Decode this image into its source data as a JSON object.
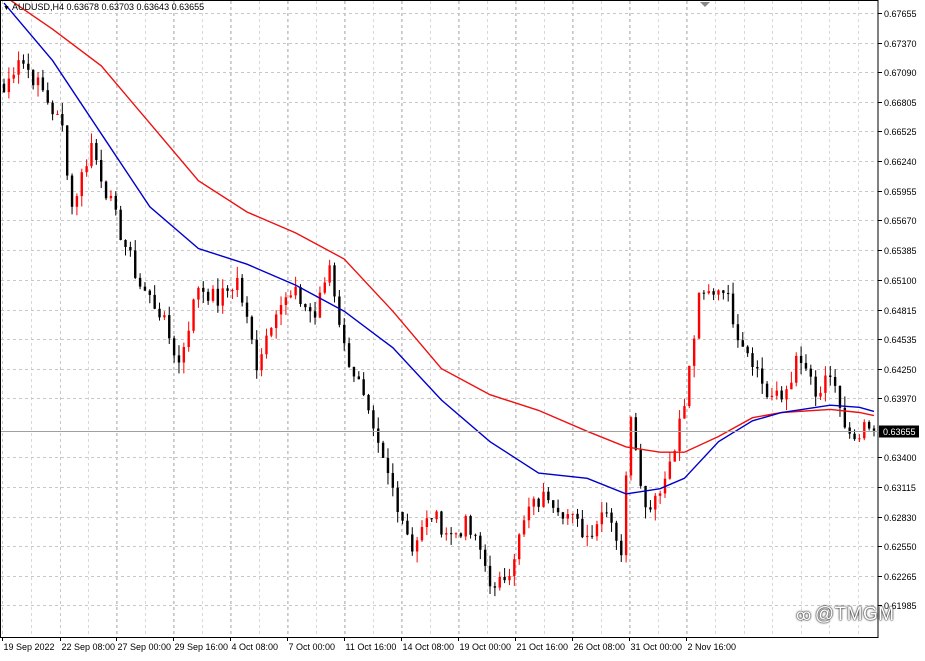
{
  "header": {
    "symbol": "AUDUSD,H4",
    "ohlc": "0.63678 0.63703 0.63643 0.63655"
  },
  "watermark": {
    "text": "@TMGM",
    "icon": "wechat-channel-icon"
  },
  "colors": {
    "background": "#ffffff",
    "grid": "#c8c8c8",
    "bull_candle": "#ff0000",
    "bear_candle": "#000000",
    "ma_fast": "#0000cc",
    "ma_slow": "#ee1111",
    "price_tag_bg": "#000000",
    "price_tag_fg": "#ffffff",
    "current_line": "#a0a0a0"
  },
  "chart_data": {
    "type": "candlestick",
    "symbol": "AUDUSD",
    "timeframe": "H4",
    "grid": true,
    "current_price": 0.63655,
    "y_ticks": [
      0.67655,
      0.6737,
      0.6709,
      0.66805,
      0.66525,
      0.6624,
      0.65955,
      0.6567,
      0.65385,
      0.651,
      0.64815,
      0.64535,
      0.6425,
      0.6397,
      0.634,
      0.63115,
      0.6283,
      0.6255,
      0.62265,
      0.61985
    ],
    "x_labels": [
      "19 Sep 2022",
      "22 Sep 08:00",
      "27 Sep 00:00",
      "29 Sep 16:00",
      "4 Oct 08:00",
      "7 Oct 00:00",
      "11 Oct 16:00",
      "14 Oct 08:00",
      "19 Oct 00:00",
      "21 Oct 16:00",
      "26 Oct 08:00",
      "31 Oct 00:00",
      "2 Nov 16:00"
    ],
    "ylim": [
      0.6168,
      0.6778
    ],
    "candle_count": 180,
    "close_anchors": [
      [
        0,
        0.669
      ],
      [
        3,
        0.6725
      ],
      [
        8,
        0.669
      ],
      [
        12,
        0.6655
      ],
      [
        14,
        0.658
      ],
      [
        18,
        0.664
      ],
      [
        20,
        0.661
      ],
      [
        24,
        0.6555
      ],
      [
        28,
        0.6505
      ],
      [
        32,
        0.648
      ],
      [
        36,
        0.643
      ],
      [
        40,
        0.6505
      ],
      [
        44,
        0.649
      ],
      [
        48,
        0.651
      ],
      [
        52,
        0.643
      ],
      [
        56,
        0.6485
      ],
      [
        60,
        0.6495
      ],
      [
        64,
        0.6475
      ],
      [
        67,
        0.6525
      ],
      [
        70,
        0.6445
      ],
      [
        73,
        0.641
      ],
      [
        76,
        0.636
      ],
      [
        80,
        0.631
      ],
      [
        84,
        0.6255
      ],
      [
        88,
        0.6285
      ],
      [
        92,
        0.6265
      ],
      [
        95,
        0.6275
      ],
      [
        98,
        0.625
      ],
      [
        101,
        0.621
      ],
      [
        104,
        0.6235
      ],
      [
        108,
        0.629
      ],
      [
        112,
        0.6305
      ],
      [
        116,
        0.6285
      ],
      [
        120,
        0.6265
      ],
      [
        124,
        0.6295
      ],
      [
        127,
        0.625
      ],
      [
        129,
        0.6385
      ],
      [
        132,
        0.629
      ],
      [
        136,
        0.632
      ],
      [
        140,
        0.639
      ],
      [
        143,
        0.649
      ],
      [
        146,
        0.65
      ],
      [
        148,
        0.6505
      ],
      [
        151,
        0.646
      ],
      [
        154,
        0.6435
      ],
      [
        157,
        0.64
      ],
      [
        160,
        0.6395
      ],
      [
        163,
        0.643
      ],
      [
        165,
        0.6425
      ],
      [
        167,
        0.6395
      ],
      [
        169,
        0.641
      ],
      [
        171,
        0.641
      ],
      [
        173,
        0.6365
      ],
      [
        175,
        0.635
      ],
      [
        177,
        0.6365
      ],
      [
        179,
        0.63655
      ]
    ],
    "ma_fast": {
      "points": [
        [
          0,
          0.6775
        ],
        [
          10,
          0.672
        ],
        [
          20,
          0.665
        ],
        [
          30,
          0.658
        ],
        [
          40,
          0.654
        ],
        [
          50,
          0.6525
        ],
        [
          60,
          0.6505
        ],
        [
          70,
          0.648
        ],
        [
          80,
          0.6445
        ],
        [
          90,
          0.6395
        ],
        [
          100,
          0.6355
        ],
        [
          110,
          0.6325
        ],
        [
          120,
          0.632
        ],
        [
          128,
          0.6305
        ],
        [
          135,
          0.631
        ],
        [
          140,
          0.632
        ],
        [
          147,
          0.6355
        ],
        [
          154,
          0.6375
        ],
        [
          160,
          0.6383
        ],
        [
          170,
          0.639
        ],
        [
          176,
          0.6388
        ],
        [
          179,
          0.6384
        ]
      ]
    },
    "ma_slow": {
      "points": [
        [
          0,
          0.6782
        ],
        [
          10,
          0.675
        ],
        [
          20,
          0.6715
        ],
        [
          30,
          0.666
        ],
        [
          40,
          0.6605
        ],
        [
          50,
          0.6575
        ],
        [
          60,
          0.6555
        ],
        [
          70,
          0.653
        ],
        [
          80,
          0.648
        ],
        [
          90,
          0.6425
        ],
        [
          100,
          0.64
        ],
        [
          110,
          0.6385
        ],
        [
          120,
          0.6365
        ],
        [
          128,
          0.635
        ],
        [
          135,
          0.6345
        ],
        [
          140,
          0.6345
        ],
        [
          147,
          0.636
        ],
        [
          154,
          0.6378
        ],
        [
          160,
          0.6383
        ],
        [
          170,
          0.6386
        ],
        [
          176,
          0.6383
        ],
        [
          179,
          0.638
        ]
      ]
    }
  }
}
